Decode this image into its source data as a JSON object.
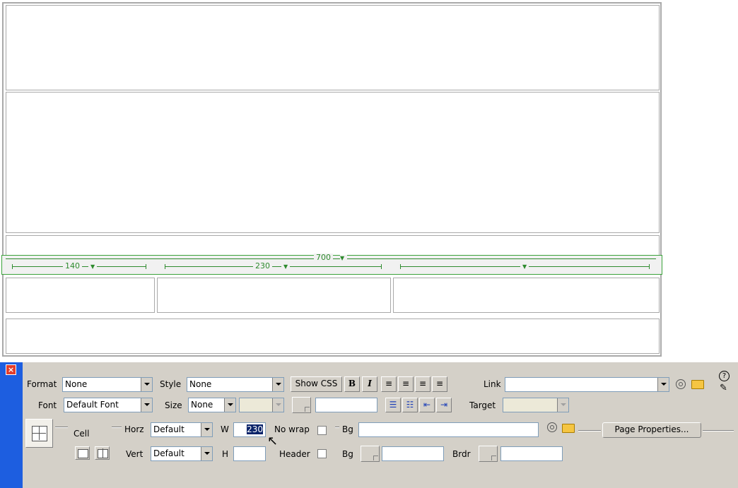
{
  "canvas": {
    "width_bar": {
      "table_width": "700",
      "columns": [
        {
          "width": "140"
        },
        {
          "width": "230"
        },
        {
          "width": ""
        }
      ]
    }
  },
  "inspector": {
    "format": {
      "label": "Format",
      "value": "None"
    },
    "style": {
      "label": "Style",
      "value": "None"
    },
    "show_css": "Show CSS",
    "bold": "B",
    "italic": "I",
    "link": {
      "label": "Link",
      "value": ""
    },
    "font": {
      "label": "Font",
      "value": "Default Font"
    },
    "size": {
      "label": "Size",
      "value": "None"
    },
    "target": {
      "label": "Target",
      "value": ""
    },
    "cell_label": "Cell",
    "horz": {
      "label": "Horz",
      "value": "Default"
    },
    "vert": {
      "label": "Vert",
      "value": "Default"
    },
    "w": {
      "label": "W",
      "value": "230"
    },
    "h": {
      "label": "H",
      "value": ""
    },
    "nowrap": {
      "label": "No wrap",
      "checked": false
    },
    "header": {
      "label": "Header",
      "checked": false
    },
    "bg1": {
      "label": "Bg",
      "value": ""
    },
    "bg2": {
      "label": "Bg",
      "value": ""
    },
    "brdr": {
      "label": "Brdr",
      "value": ""
    },
    "page_properties": "Page Properties...",
    "help_icon": "question-icon"
  }
}
